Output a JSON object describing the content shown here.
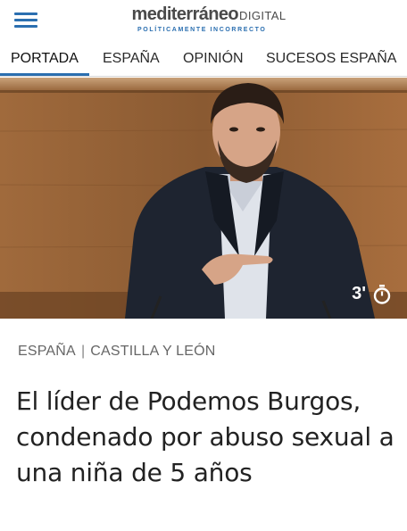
{
  "header": {
    "menu_icon": "hamburger-menu-icon",
    "logo": {
      "main": "mediterráneo",
      "suffix": "DIGITAL",
      "tagline": "POLÍTICAMENTE INCORRECTO"
    },
    "accent_color": "#2b6fb0"
  },
  "nav": {
    "tabs": [
      {
        "label": "PORTADA",
        "active": true
      },
      {
        "label": "ESPAÑA",
        "active": false
      },
      {
        "label": "OPINIÓN",
        "active": false
      },
      {
        "label": "SUCESOS ESPAÑA",
        "active": false
      }
    ]
  },
  "article": {
    "read_time": "3'",
    "read_time_icon": "clock-icon",
    "section": "ESPAÑA",
    "subsection": "CASTILLA Y LEÓN",
    "separator": "|",
    "headline": "El líder de Podemos Burgos, condenado por abuso sexual a una niña de 5 años"
  }
}
